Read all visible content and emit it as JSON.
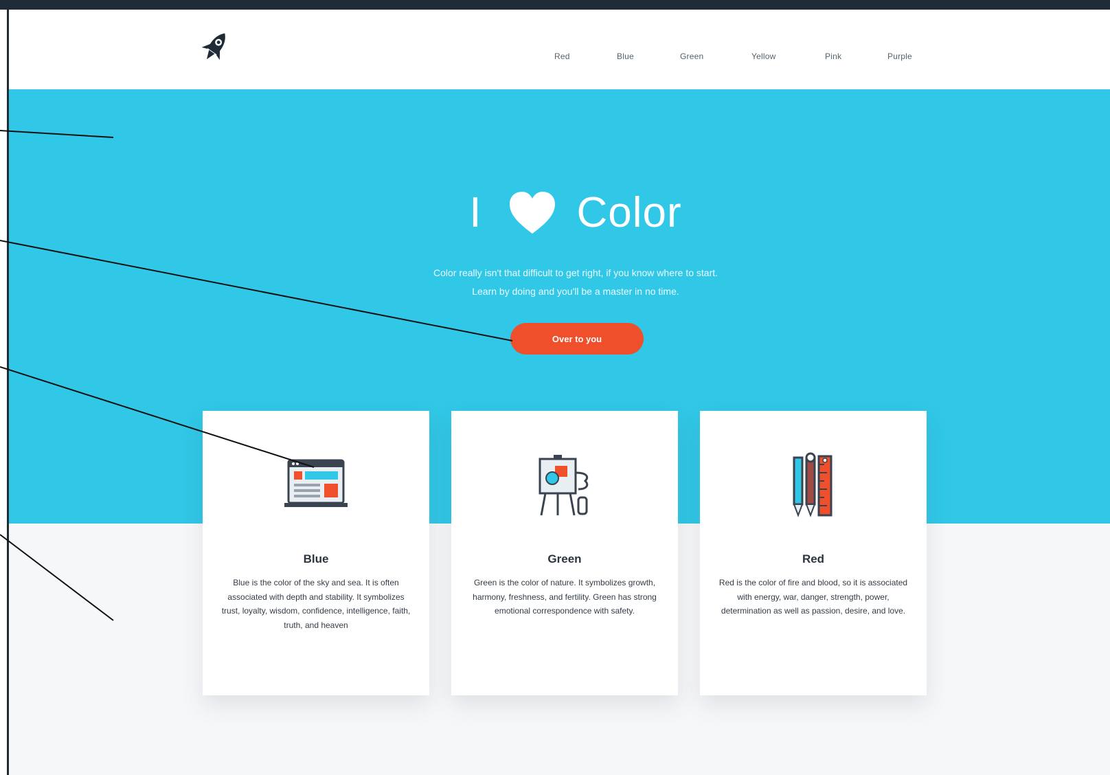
{
  "nav": {
    "items": [
      {
        "label": "Red"
      },
      {
        "label": "Blue"
      },
      {
        "label": "Green"
      },
      {
        "label": "Yellow"
      },
      {
        "label": "Pink"
      },
      {
        "label": "Purple"
      }
    ]
  },
  "hero": {
    "title_prefix": "I",
    "title_suffix": "Color",
    "subtitle_line1": "Color really isn't that difficult to get right, if you know where to start.",
    "subtitle_line2": "Learn by doing and you'll be a master in no time.",
    "cta_label": "Over to you"
  },
  "cards": [
    {
      "title": "Blue",
      "text": "Blue is the color of the sky and sea. It is often associated with depth and stability. It symbolizes trust, loyalty, wisdom, confidence, intelligence, faith, truth, and heaven",
      "icon": "browser-window-icon"
    },
    {
      "title": "Green",
      "text": "Green is the color of nature. It symbolizes growth, harmony, freshness, and fertility. Green has strong emotional correspondence with safety.",
      "icon": "easel-palette-icon"
    },
    {
      "title": "Red",
      "text": "Red is the color of fire and blood, so it is associated with energy, war, danger, strength, power, determination as well as passion, desire, and love.",
      "icon": "pencils-ruler-icon"
    }
  ],
  "colors": {
    "hero_background": "#31c7e6",
    "cta_background": "#f04f2c",
    "page_background": "#f6f7f9",
    "frame": "#1f2b37"
  }
}
